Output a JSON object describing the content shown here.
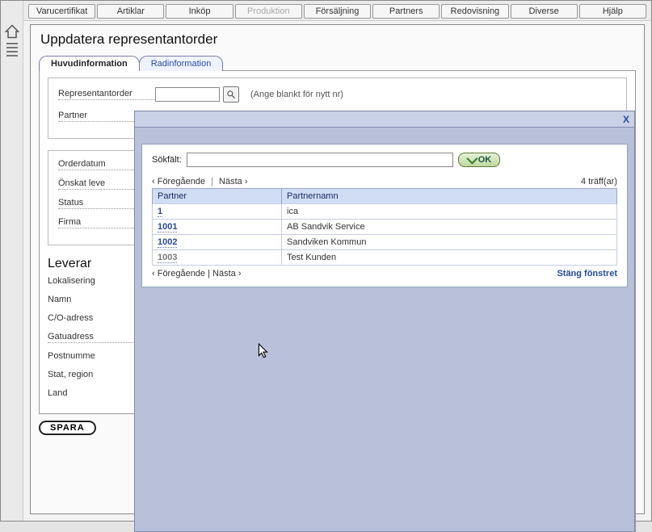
{
  "menu": {
    "items": [
      {
        "label": "Varucertifikat",
        "disabled": false
      },
      {
        "label": "Artiklar",
        "disabled": false
      },
      {
        "label": "Inköp",
        "disabled": false
      },
      {
        "label": "Produktion",
        "disabled": true
      },
      {
        "label": "Försäljning",
        "disabled": false
      },
      {
        "label": "Partners",
        "disabled": false
      },
      {
        "label": "Redovisning",
        "disabled": false
      },
      {
        "label": "Diverse",
        "disabled": false
      },
      {
        "label": "Hjälp",
        "disabled": false
      }
    ]
  },
  "page": {
    "title": "Uppdatera representantorder"
  },
  "tabs": {
    "t1": "Huvudinformation",
    "t2": "Radinformation"
  },
  "fields": {
    "order_label": "Representantorder",
    "order_hint": "(Ange blankt för nytt nr)",
    "partner_label": "Partner",
    "orderdatum": "Orderdatum",
    "onskat": "Önskat leveransdatum",
    "status": "Status",
    "firma": "Firma",
    "leverans_title": "Leveransadress",
    "lokal": "Lokalisering",
    "namn": "Namn",
    "co": "C/O-adress",
    "gatu": "Gatuadress",
    "postnr": "Postnummer",
    "stat": "Stat, region",
    "land": "Land"
  },
  "bottom": {
    "save": "SPARA"
  },
  "modal": {
    "close_x": "X",
    "searchlabel": "Sökfält:",
    "ok": "OK",
    "prev": "‹ Föregående",
    "next": "Nästa ›",
    "sep": " | ",
    "hits": "4 träff(ar)",
    "col1": "Partner",
    "col2": "Partnernamn",
    "rows": [
      {
        "id": "1",
        "name": "ica"
      },
      {
        "id": "1001",
        "name": "AB Sandvik Service"
      },
      {
        "id": "1002",
        "name": "Sandviken Kommun"
      },
      {
        "id": "1003",
        "name": "Test Kunden"
      }
    ],
    "closewin": "Stäng fönstret"
  }
}
